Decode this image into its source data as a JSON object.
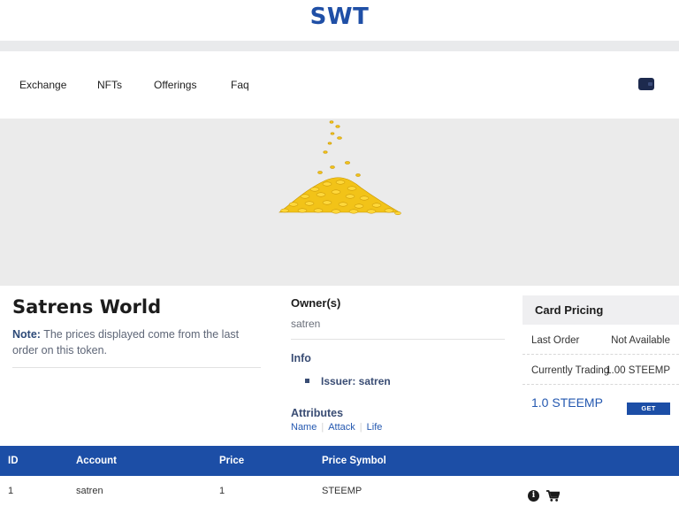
{
  "header": {
    "brand": "SWT"
  },
  "nav": {
    "items": [
      "Exchange",
      "NFTs",
      "Offerings",
      "Faq"
    ],
    "wallet_icon": "wallet-icon"
  },
  "hero": {
    "image": "gold-coins-pile",
    "accent": "#f4c20d"
  },
  "token": {
    "title": "Satrens World",
    "note_label": "Note:",
    "note_text": "The prices displayed come from the last order on this token."
  },
  "owner": {
    "heading": "Owner(s)",
    "value": "satren",
    "info_heading": "Info",
    "issuer": "Issuer: satren",
    "attributes_heading": "Attributes",
    "attributes": [
      "Name",
      "Attack",
      "Life"
    ]
  },
  "card_pricing": {
    "heading": "Card Pricing",
    "rows": [
      {
        "label": "Last Order",
        "value": "Not Available"
      },
      {
        "label": "Currently Trading",
        "value": "1.00 STEEMP"
      }
    ],
    "price": "1.0 STEEMP",
    "button": "GET"
  },
  "table": {
    "headers": [
      "ID",
      "Account",
      "Price",
      "Price Symbol"
    ],
    "rows": [
      {
        "id": "1",
        "account": "satren",
        "price": "1",
        "symbol": "STEEMP"
      }
    ],
    "row_icons": [
      "info-icon",
      "cart-icon"
    ]
  },
  "colors": {
    "brand": "#1f4fa6",
    "table_header": "#1c4ea6",
    "link": "#2458b0"
  }
}
